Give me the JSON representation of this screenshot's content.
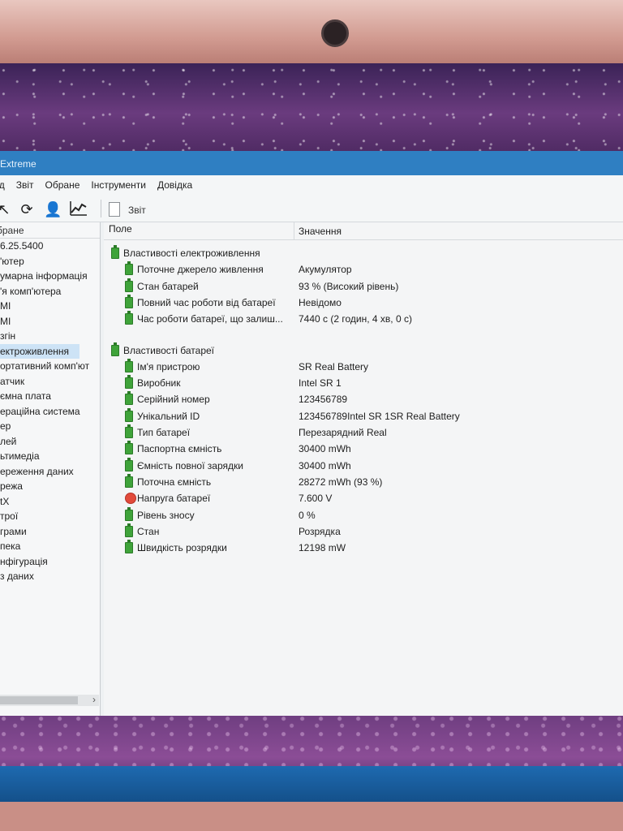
{
  "window": {
    "title": "Extreme"
  },
  "menu": [
    "ид",
    "Звіт",
    "Обране",
    "Інструменти",
    "Довідка"
  ],
  "toolbar": {
    "icons": [
      "back-arrow-icon",
      "refresh-icon",
      "user-icon",
      "chart-icon"
    ],
    "report_label": "Звіт"
  },
  "left_pane": {
    "header": "бране",
    "items": [
      "6.25.5400",
      "'ютер",
      "умарна інформація",
      "'я комп'ютера",
      "MI",
      "MI",
      "згін",
      "ектроживлення",
      "ортативний комп'ют",
      "атчик",
      "ємна плата",
      "ераційна система",
      "ер",
      "лей",
      "ьтимедіа",
      "ереження даних",
      "режа",
      "tX",
      "трої",
      "грами",
      "пека",
      "нфігурація",
      "з даних"
    ],
    "selected_index": 7
  },
  "columns": {
    "field": "Поле",
    "value": "Значення"
  },
  "sections": [
    {
      "title": "Властивості електроживлення",
      "rows": [
        {
          "field": "Поточне джерело живлення",
          "value": "Акумулятор",
          "icon": "battery-icon"
        },
        {
          "field": "Стан батарей",
          "value": "93 % (Високий рівень)",
          "icon": "battery-icon"
        },
        {
          "field": "Повний час роботи від батареї",
          "value": "Невідомо",
          "icon": "battery-icon"
        },
        {
          "field": "Час роботи батареї, що залиш...",
          "value": "7440 с (2 годин, 4 хв, 0 с)",
          "icon": "battery-icon"
        }
      ]
    },
    {
      "title": "Властивості батареї",
      "rows": [
        {
          "field": "Ім'я пристрою",
          "value": "SR Real Battery",
          "icon": "battery-icon"
        },
        {
          "field": "Виробник",
          "value": "Intel SR 1",
          "icon": "battery-icon"
        },
        {
          "field": "Серійний номер",
          "value": "123456789",
          "icon": "battery-icon"
        },
        {
          "field": "Унікальний ID",
          "value": "123456789Intel SR 1SR Real Battery",
          "icon": "battery-icon"
        },
        {
          "field": "Тип батареї",
          "value": "Перезарядний Real",
          "icon": "battery-icon"
        },
        {
          "field": "Паспортна ємність",
          "value": "30400 mWh",
          "icon": "battery-icon"
        },
        {
          "field": "Ємність повної зарядки",
          "value": "30400 mWh",
          "icon": "battery-icon"
        },
        {
          "field": "Поточна ємність",
          "value": "28272 mWh  (93 %)",
          "icon": "battery-icon"
        },
        {
          "field": "Напруга батареї",
          "value": "7.600 V",
          "icon": "voltage-bolt-icon"
        },
        {
          "field": "Рівень зносу",
          "value": "0 %",
          "icon": "battery-icon"
        },
        {
          "field": "Стан",
          "value": "Розрядка",
          "icon": "battery-icon"
        },
        {
          "field": "Швидкість розрядки",
          "value": "12198 mW",
          "icon": "battery-icon"
        }
      ]
    }
  ]
}
